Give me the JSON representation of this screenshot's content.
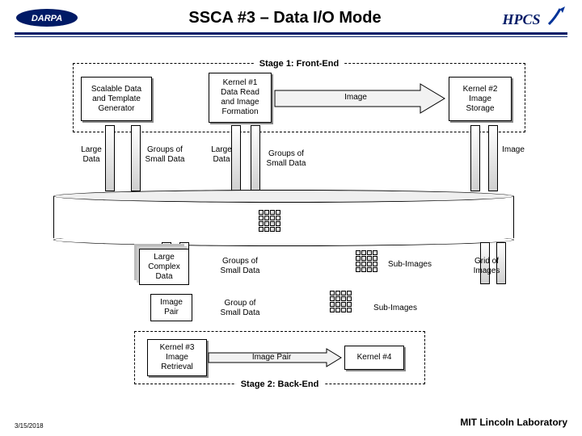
{
  "header": {
    "title": "SSCA #3 – Data I/O Mode"
  },
  "logos": {
    "left_alt": "DARPA",
    "right_alt": "HPCS"
  },
  "stage1": {
    "label": "Stage 1:  Front-End"
  },
  "stage2": {
    "label": "Stage 2:  Back-End"
  },
  "boxes": {
    "generator": "Scalable Data\nand Template\nGenerator",
    "kernel1": "Kernel #1\nData Read\nand Image\nFormation",
    "kernel2": "Kernel #2\nImage\nStorage",
    "kernel3": "Kernel #3\nImage\nRetrieval",
    "kernel4": "Kernel #4",
    "large_complex": "Large\nComplex\nData",
    "image_pair": "Image\nPair"
  },
  "labels": {
    "image_arrow": "Image",
    "large_data_1": "Large\nData",
    "large_data_2": "Large\nData",
    "groups_small_1": "Groups of\nSmall Data",
    "groups_small_2": "Groups of\nSmall Data",
    "groups_small_3": "Groups of\nSmall Data",
    "group_small": "Group of\nSmall Data",
    "image_top": "Image",
    "sub_images_1": "Sub-Images",
    "sub_images_2": "Sub-Images",
    "grid_images": "Grid of\nImages",
    "image_pair_lbl": "Image Pair"
  },
  "footer": {
    "date": "3/15/2018",
    "lab": "MIT Lincoln Laboratory"
  }
}
